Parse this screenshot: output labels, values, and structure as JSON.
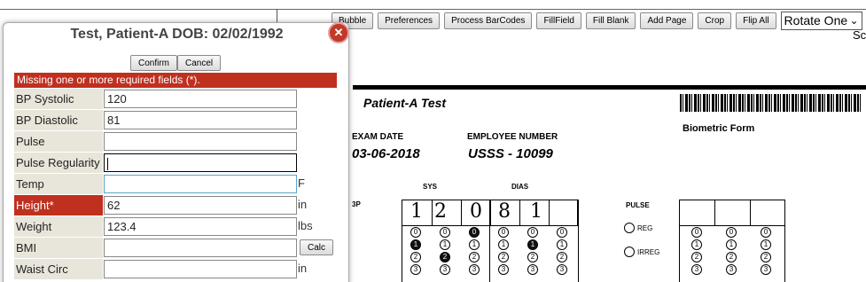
{
  "toolbar": {
    "buttons": [
      "Bubble",
      "Preferences",
      "Process BarCodes",
      "FillField",
      "Fill Blank",
      "Add Page",
      "Crop",
      "Flip All"
    ],
    "rotate_value": "Rotate One",
    "cut_text": "Sc"
  },
  "document": {
    "patient_name": "Patient-A Test",
    "form_title": "Biometric Form",
    "exam_date_label": "EXAM DATE",
    "exam_date_value": "03-06-2018",
    "employee_label": "EMPLOYEE NUMBER",
    "employee_value": "USSS - 10099",
    "sys_label": "SYS",
    "dias_label": "DIAS",
    "bp_label": "3P",
    "pulse_label": "PULSE",
    "reg_label": "REG",
    "irreg_label": "IRREG",
    "handwritten_digits": [
      "1",
      "2",
      "0",
      "8",
      "1"
    ]
  },
  "modal": {
    "title": "Test, Patient-A  DOB: 02/02/1992",
    "confirm_label": "Confirm",
    "cancel_label": "Cancel",
    "error_message": "Missing one or more required fields (*).",
    "calc_label": "Calc",
    "fields": [
      {
        "label": "BP Systolic",
        "value": "120",
        "unit": ""
      },
      {
        "label": "BP Diastolic",
        "value": "81",
        "unit": ""
      },
      {
        "label": "Pulse",
        "value": "",
        "unit": ""
      },
      {
        "label": "Pulse Regularity",
        "value": "",
        "unit": ""
      },
      {
        "label": "Temp",
        "value": "",
        "unit": "F"
      },
      {
        "label": "Height*",
        "value": "62",
        "unit": "in"
      },
      {
        "label": "Weight",
        "value": "123.4",
        "unit": "lbs"
      },
      {
        "label": "BMI",
        "value": "",
        "unit": ""
      },
      {
        "label": "Waist Circ",
        "value": "",
        "unit": "in"
      }
    ]
  },
  "colors": {
    "error_red": "#c0301f",
    "label_bg": "#e8e5da"
  }
}
